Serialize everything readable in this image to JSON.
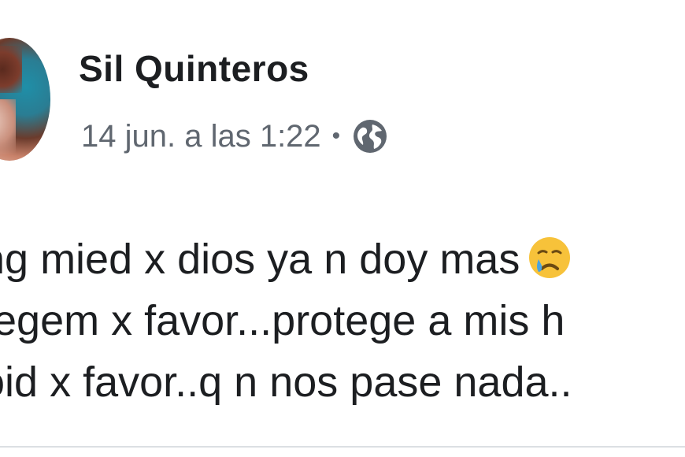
{
  "post": {
    "author_name": "Sil Quinteros",
    "timestamp": "14 jun. a las 1:22",
    "separator": "•",
    "privacy_icon": "globe-icon",
    "body_lines": [
      "ng mied x dios ya n doy mas",
      "tegem x favor...protege a mis h",
      "oid x favor..q n nos pase nada.."
    ],
    "emoji": "crying-face-emoji"
  },
  "colors": {
    "name_text": "#1c1e21",
    "meta_text": "#606770",
    "body_text": "#1c1e21",
    "background": "#ffffff"
  }
}
